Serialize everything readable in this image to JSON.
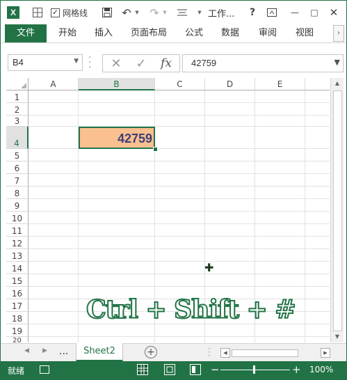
{
  "titlebar": {
    "app_icon_letter": "X",
    "gridlines_label": "网格线",
    "gridlines_checked": "✓",
    "title": "工作...",
    "help": "?",
    "minimize": "—",
    "maximize": "□",
    "close": "✕"
  },
  "ribbon": {
    "tabs": [
      "文件",
      "开始",
      "插入",
      "页面布局",
      "公式",
      "数据",
      "审阅",
      "视图"
    ],
    "more": "›"
  },
  "formula_bar": {
    "name_box": "B4",
    "value": "42759"
  },
  "sheet": {
    "columns": [
      "A",
      "B",
      "C",
      "D",
      "E"
    ],
    "active_column": "B",
    "rows": [
      "1",
      "2",
      "3",
      "4",
      "5",
      "6",
      "7",
      "8",
      "9",
      "10",
      "11",
      "12",
      "13",
      "14",
      "15",
      "16",
      "17",
      "18",
      "19",
      "20"
    ],
    "active_row": "4",
    "active_cell": {
      "address": "B4",
      "value": "42759",
      "fill_color": "#fac090",
      "text_color": "#3f3f76"
    },
    "overlay_text": "Ctrl + Shift + #"
  },
  "sheet_tabs": {
    "ellipsis": "...",
    "active_tab": "Sheet2",
    "add": "+"
  },
  "statusbar": {
    "status": "就绪",
    "zoom_minus": "−",
    "zoom_plus": "+",
    "zoom_level": "100%"
  },
  "colors": {
    "accent": "#217346",
    "cell_fill": "#fac090",
    "cell_text": "#3f3f76"
  }
}
